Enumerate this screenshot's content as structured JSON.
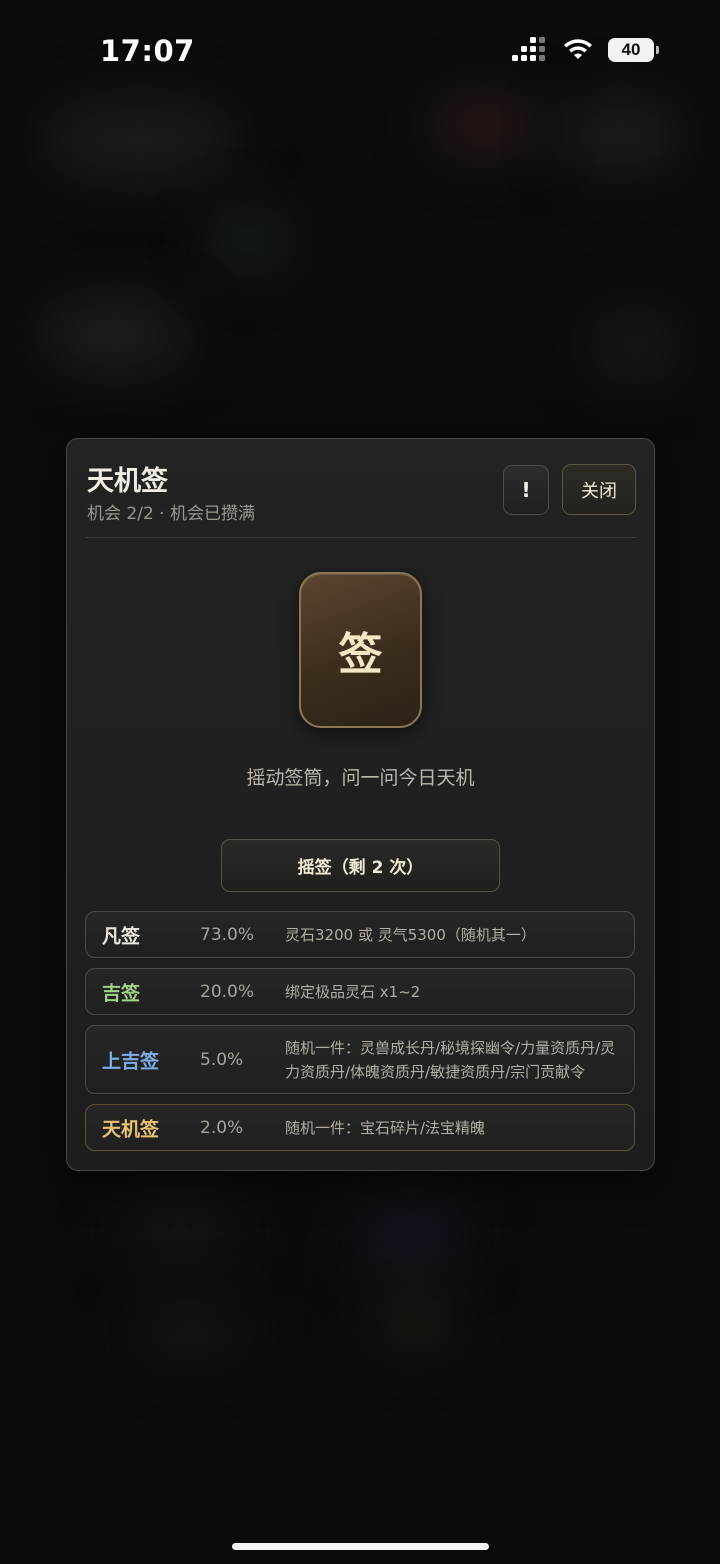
{
  "status_bar": {
    "time": "17:07",
    "battery": "40"
  },
  "panel": {
    "title": "天机签",
    "subtitle": "机会 2/2 · 机会已攒满",
    "info_button": "!",
    "close_button": "关闭",
    "card_char": "签",
    "hint": "摇动签筒，问一问今日天机",
    "draw_button": "摇签（剩 2 次）"
  },
  "tiers": [
    {
      "name": "凡签",
      "probability": "73.0%",
      "reward": "灵石3200 或 灵气5300（随机其一）",
      "color": "#ece8df"
    },
    {
      "name": "吉签",
      "probability": "20.0%",
      "reward": "绑定极品灵石 x1~2",
      "color": "#9fd487"
    },
    {
      "name": "上吉签",
      "probability": "5.0%",
      "reward": "随机一件：灵兽成长丹/秘境探幽令/力量资质丹/灵力资质丹/体魄资质丹/敏捷资质丹/宗门贡献令",
      "color": "#7eaee8"
    },
    {
      "name": "天机签",
      "probability": "2.0%",
      "reward": "随机一件：宝石碎片/法宝精魄",
      "color": "#e9c173"
    }
  ]
}
